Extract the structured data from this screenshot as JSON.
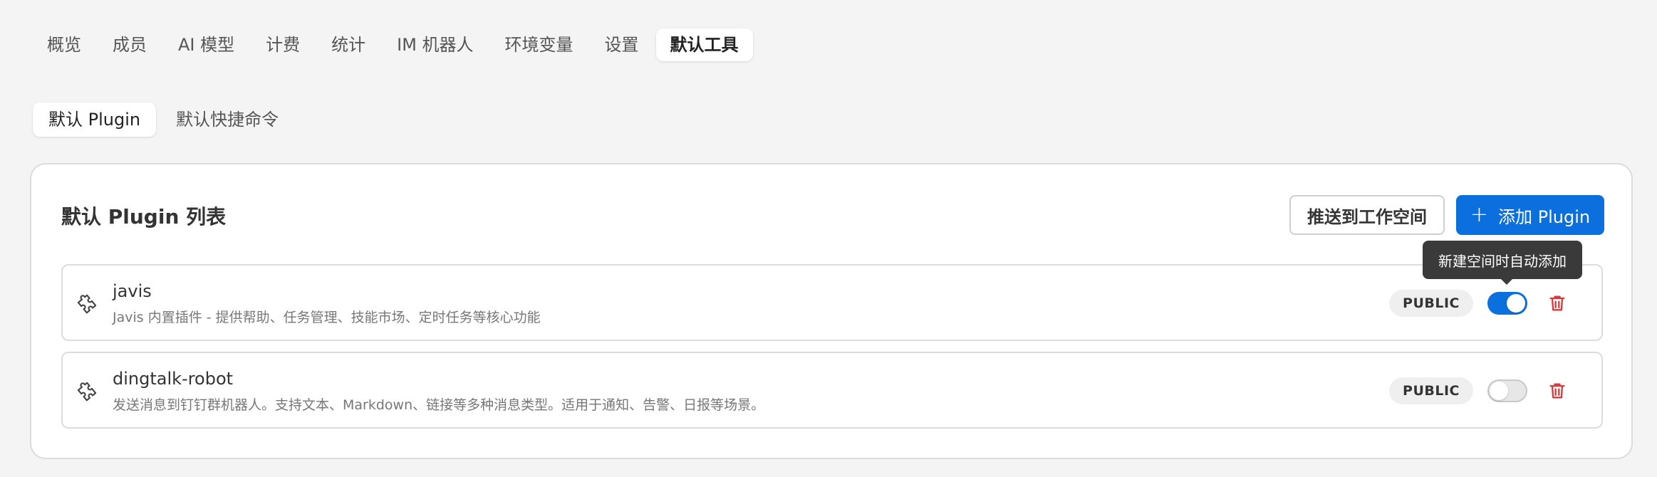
{
  "top_tabs": [
    {
      "label": "概览"
    },
    {
      "label": "成员"
    },
    {
      "label": "AI 模型"
    },
    {
      "label": "计费"
    },
    {
      "label": "统计"
    },
    {
      "label": "IM 机器人"
    },
    {
      "label": "环境变量"
    },
    {
      "label": "设置"
    },
    {
      "label": "默认工具",
      "active": true
    }
  ],
  "sub_tabs": [
    {
      "label": "默认 Plugin",
      "active": true
    },
    {
      "label": "默认快捷命令"
    }
  ],
  "card": {
    "title": "默认 Plugin 列表",
    "push_button": "推送到工作空间",
    "add_button": "添加 Plugin",
    "add_icon": "plus-icon"
  },
  "plugins": [
    {
      "icon": "puzzle-icon",
      "name": "javis",
      "description": "Javis 内置插件 - 提供帮助、任务管理、技能市场、定时任务等核心功能",
      "visibility": "PUBLIC",
      "auto_add": true
    },
    {
      "icon": "puzzle-icon",
      "name": "dingtalk-robot",
      "description": "发送消息到钉钉群机器人。支持文本、Markdown、链接等多种消息类型。适用于通知、告警、日报等场景。",
      "visibility": "PUBLIC",
      "auto_add": false
    }
  ],
  "tooltip": {
    "text": "新建空间时自动添加"
  },
  "colors": {
    "accent": "#0b6fde",
    "danger": "#d93a3a",
    "background": "#f4f4f4"
  }
}
